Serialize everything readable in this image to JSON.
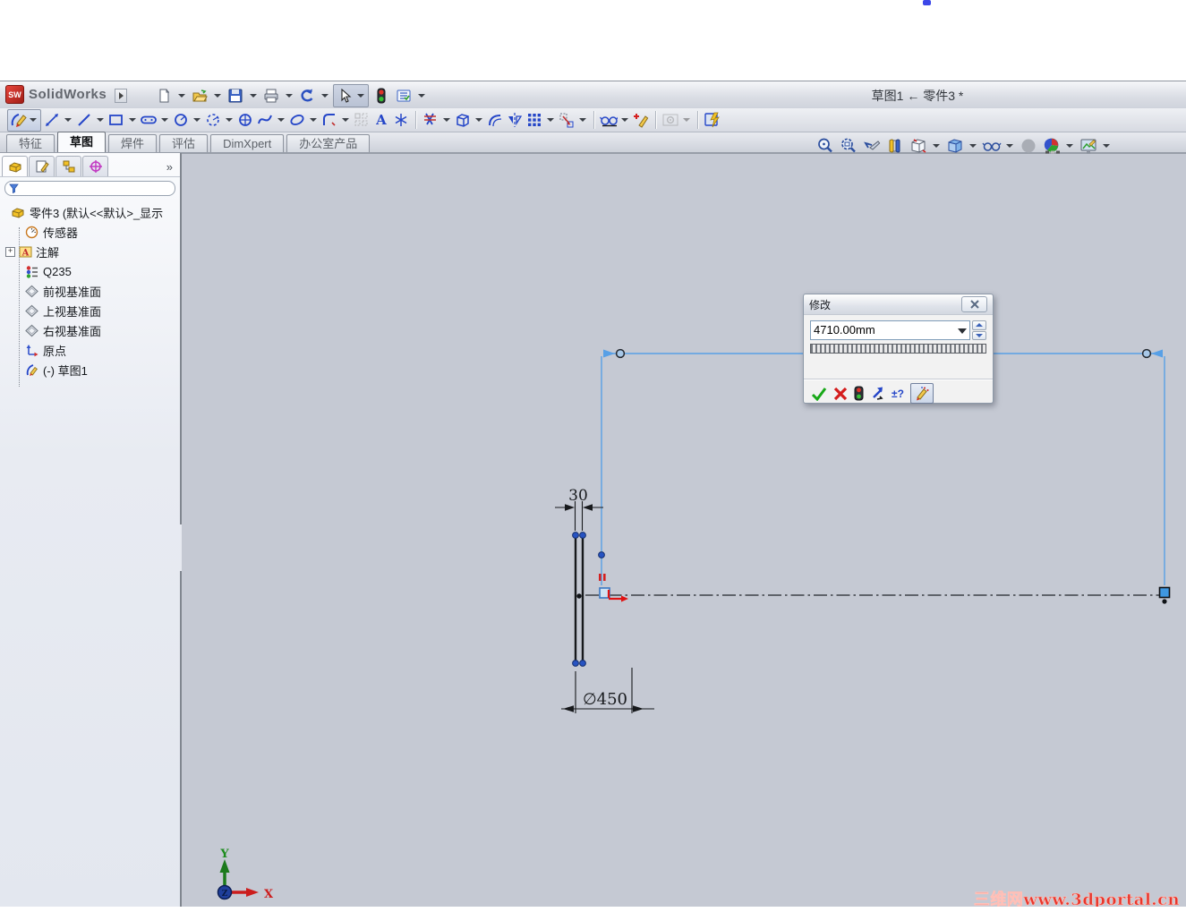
{
  "titlebar": {
    "app_name": "SolidWorks",
    "doc_title": "草图1 ← 零件3 *"
  },
  "toolbar_main": {
    "icons": [
      "new",
      "open",
      "save",
      "print",
      "undo",
      "select",
      "rebuild-traffic-light",
      "options-list"
    ]
  },
  "toolbar_sketch": {
    "icons": [
      "sketch",
      "smart-dimension",
      "line",
      "rectangle",
      "slot",
      "circle",
      "arc",
      "polygon",
      "spline",
      "ellipse",
      "sketch-fillet",
      "pattern",
      "sketch-text",
      "point",
      "trim-entities",
      "convert-entities",
      "offset-entities",
      "mirror-entities",
      "linear-pattern",
      "move-entities",
      "display-relations",
      "add-relation",
      "instant-2d",
      "shaded-sketch-contours"
    ]
  },
  "command_tabs": {
    "items": [
      {
        "label": "特征",
        "active": false
      },
      {
        "label": "草图",
        "active": true
      },
      {
        "label": "焊件",
        "active": false
      },
      {
        "label": "评估",
        "active": false
      },
      {
        "label": "DimXpert",
        "active": false
      },
      {
        "label": "办公室产品",
        "active": false
      }
    ]
  },
  "panel": {
    "tabs": [
      "feature-manager",
      "property-manager",
      "configuration-manager",
      "dimxpert-manager"
    ],
    "more_chevron": "»",
    "filter_value": "",
    "tree": {
      "items": [
        {
          "label": "零件3 (默认<<默认>_显示"
        },
        {
          "label": "传感器"
        },
        {
          "label": "注解"
        },
        {
          "label": "Q235"
        },
        {
          "label": "前视基准面"
        },
        {
          "label": "上视基准面"
        },
        {
          "label": "右视基准面"
        },
        {
          "label": "原点"
        },
        {
          "label": "(-) 草图1"
        }
      ]
    }
  },
  "headsup": {
    "icons": [
      "zoom-to-fit",
      "zoom-to-area",
      "previous-view",
      "section-view",
      "view-orientation",
      "display-style",
      "hide-show-items",
      "shadow-sphere",
      "edit-appearance",
      "apply-scene"
    ]
  },
  "modify_dialog": {
    "title": "修改",
    "value": "4710.00mm",
    "spin_label": "±?",
    "buttons": [
      "accept",
      "cancel",
      "rebuild",
      "reverse-direction",
      "spin-increment",
      "dimension-wand"
    ]
  },
  "sketch": {
    "width_dim": "30",
    "diameter_dim": "∅450",
    "editing_dim_value": "4710.00mm"
  },
  "triad": {
    "x": "X",
    "y": "Y",
    "z": "Z"
  },
  "watermark": {
    "text": "三维网www.3dportal.cn"
  },
  "colors": {
    "canvas": "#c5c9d3",
    "sketch_blue": "#58a0e6",
    "geometry": "#17191c",
    "handle_blue": "#2753c2",
    "accent_red": "#d42020",
    "accent_green": "#18a818"
  }
}
